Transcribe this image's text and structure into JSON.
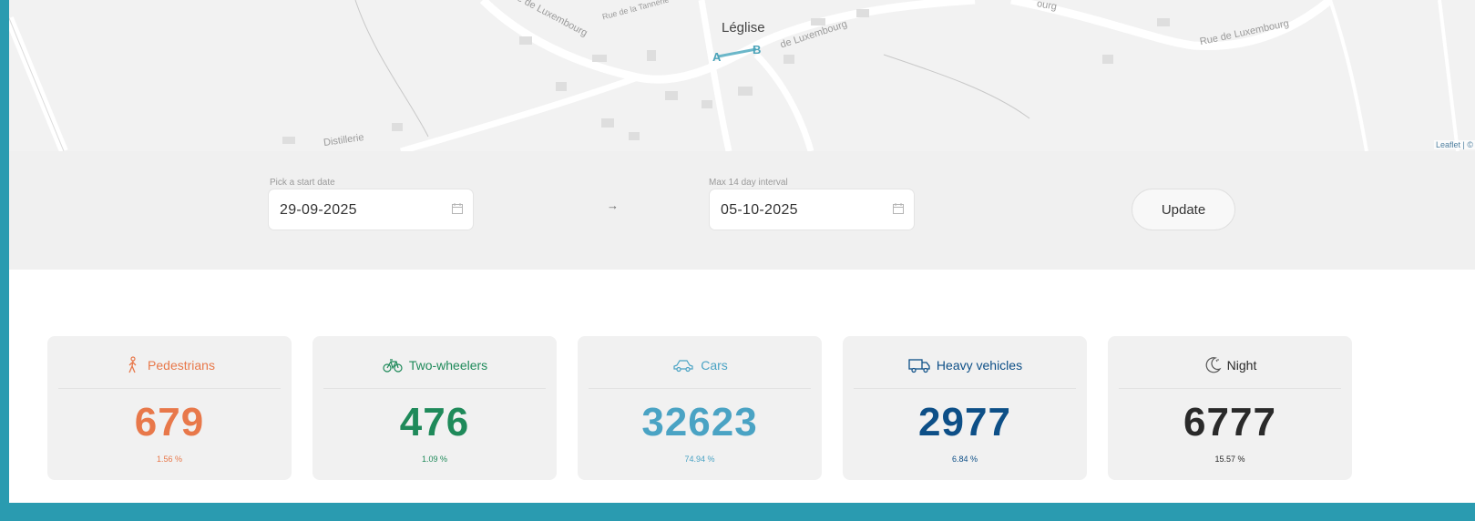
{
  "map": {
    "town": "Léglise",
    "streets": [
      "Rue de Luxembourg",
      "Rue de la Tannerie",
      "de Luxembourg",
      "Rue de Luxembourg",
      "Distillerie",
      "ourg"
    ],
    "marker_a": "A",
    "marker_b": "B",
    "attribution": "Leaflet | ©"
  },
  "controls": {
    "start": {
      "caption": "Pick a start date",
      "value": "29-09-2025"
    },
    "arrow": "→",
    "end": {
      "caption": "Max 14 day interval",
      "value": "05-10-2025"
    },
    "update_label": "Update"
  },
  "cards": [
    {
      "label": "Pedestrians",
      "count": "679",
      "pct": "1.56 %",
      "color": "#e8784a",
      "icon": "pedestrian-icon"
    },
    {
      "label": "Two-wheelers",
      "count": "476",
      "pct": "1.09 %",
      "color": "#1f8a5a",
      "icon": "bicycle-icon"
    },
    {
      "label": "Cars",
      "count": "32623",
      "pct": "74.94 %",
      "color": "#4aa3c4",
      "icon": "car-icon"
    },
    {
      "label": "Heavy vehicles",
      "count": "2977",
      "pct": "6.84 %",
      "color": "#0d4f87",
      "icon": "truck-icon"
    },
    {
      "label": "Night",
      "count": "6777",
      "pct": "15.57 %",
      "color": "#2a2a2a",
      "icon": "night-icon"
    }
  ]
}
